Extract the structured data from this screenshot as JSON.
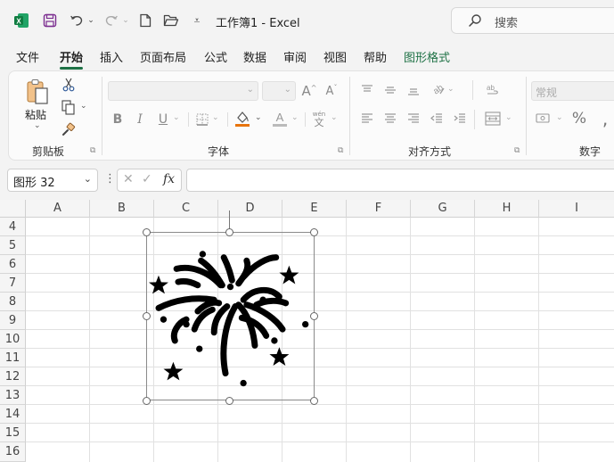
{
  "app": {
    "title": "工作簿1 - Excel"
  },
  "search": {
    "label": "搜索"
  },
  "menu": {
    "tabs": [
      "文件",
      "开始",
      "插入",
      "页面布局",
      "公式",
      "数据",
      "审阅",
      "视图",
      "帮助",
      "图形格式"
    ],
    "active": "开始"
  },
  "ribbon": {
    "clipboard": {
      "paste_label": "粘贴",
      "group_label": "剪贴板"
    },
    "font": {
      "group_label": "字体",
      "font_name": "",
      "font_size": "",
      "phonetic_label": "wén"
    },
    "alignment": {
      "group_label": "对齐方式"
    },
    "number": {
      "format_value": "常规",
      "group_label": "数字"
    }
  },
  "formula_bar": {
    "name_box": "图形 32",
    "fx_label": "fx",
    "formula": ""
  },
  "sheet": {
    "columns": [
      "A",
      "B",
      "C",
      "D",
      "E",
      "F",
      "G",
      "H",
      "I"
    ],
    "rows": [
      "4",
      "5",
      "6",
      "7",
      "8",
      "9",
      "10",
      "11",
      "12",
      "13",
      "14",
      "15",
      "16"
    ],
    "selected_shape": "fireworks-icon"
  },
  "colors": {
    "accent": "#1e7145",
    "font_color_bar": "#e8740c"
  }
}
